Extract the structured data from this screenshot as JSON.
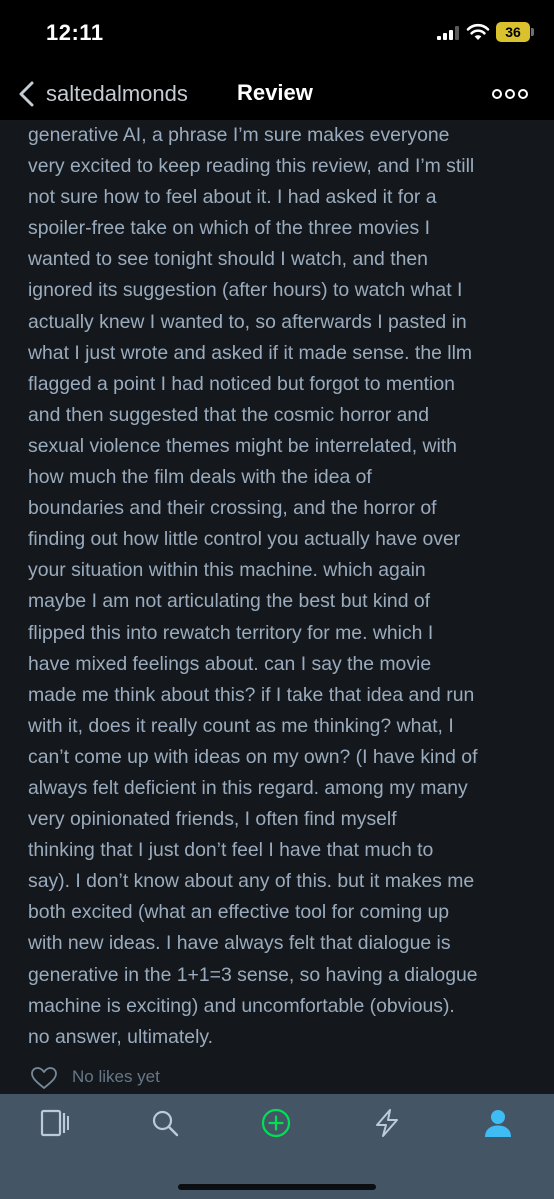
{
  "status_bar": {
    "time": "12:11",
    "battery": "36"
  },
  "nav": {
    "back_user": "saltedalmonds",
    "title": "Review"
  },
  "review_lines": [
    "generative AI, a phrase I’m sure makes everyone",
    "very excited to keep reading this review, and I’m still",
    "not sure how to feel about it. I had asked it for a",
    "spoiler-free take on which of the three movies I",
    "wanted to see tonight should I watch, and then",
    "ignored its suggestion (after hours) to watch what I",
    "actually knew I wanted to, so afterwards I pasted in",
    "what I just wrote and asked if it made sense. the llm",
    "flagged a point I had noticed but forgot to mention",
    "and then suggested that the cosmic horror and",
    "sexual violence themes might be interrelated, with",
    "how much the film deals with the idea of",
    "boundaries and their crossing, and the horror of",
    "finding out how little control you actually have over",
    "your situation within this machine. which again",
    "maybe I am not articulating the best but kind of",
    "flipped this into rewatch territory for me. which I",
    "have mixed feelings about. can I say the movie",
    "made me think about this? if I take that idea and run",
    "with it, does it really count as me thinking? what, I",
    "can’t come up with ideas on my own? (I have kind of",
    "always felt deficient in this regard. among my many",
    "very opinionated friends, I often find myself",
    "thinking that I just don’t feel I have that much to",
    "say). I don’t know about any of this. but it makes me",
    "both excited (what an effective tool for coming up",
    "with new ideas. I have always felt that dialogue is",
    "generative in the 1+1=3 sense, so having a dialogue",
    "machine is exciting) and uncomfortable (obvious).",
    "no answer, ultimately."
  ],
  "likes": {
    "label": "No likes yet"
  },
  "tabs": [
    {
      "icon": "films-icon"
    },
    {
      "icon": "search-icon"
    },
    {
      "icon": "add-icon",
      "color": "#00e054"
    },
    {
      "icon": "activity-icon"
    },
    {
      "icon": "profile-icon",
      "color": "#40bcf4"
    }
  ],
  "colors": {
    "accent_green": "#00e054",
    "accent_blue": "#40bcf4",
    "tab_bar": "#445566"
  }
}
